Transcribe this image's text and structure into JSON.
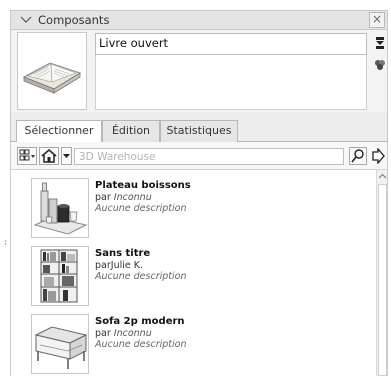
{
  "panel": {
    "title": "Composants",
    "close_symbol": "×"
  },
  "selected": {
    "name": "Livre ouvert",
    "description": "",
    "thumbnail_icon": "open-book-thumbnail"
  },
  "side_icons": [
    "display-secondary-pane-icon",
    "component-details-icon"
  ],
  "tabs": [
    {
      "label": "Sélectionner",
      "active": true
    },
    {
      "label": "Édition",
      "active": false
    },
    {
      "label": "Statistiques",
      "active": false
    }
  ],
  "toolbar": {
    "view_options_icon": "view-options-icon",
    "home_icon": "home-icon",
    "dropdown_icon": "dropdown-arrow-icon",
    "search_placeholder": "3D Warehouse",
    "search_value": "",
    "search_icon": "search-icon",
    "details_icon": "arrow-right-icon"
  },
  "results": [
    {
      "title": "Plateau boissons",
      "by": "par",
      "author": "Inconnu",
      "author_italic": true,
      "description": "Aucune description",
      "icon": "drinks-tray-thumbnail"
    },
    {
      "title": "Sans titre",
      "by": "par",
      "author": "Julie K.",
      "author_italic": false,
      "description": "Aucune description",
      "icon": "bookshelf-thumbnail"
    },
    {
      "title": "Sofa 2p modern",
      "by": "par",
      "author": "Inconnu",
      "author_italic": true,
      "description": "Aucune description",
      "icon": "sofa-thumbnail"
    }
  ]
}
